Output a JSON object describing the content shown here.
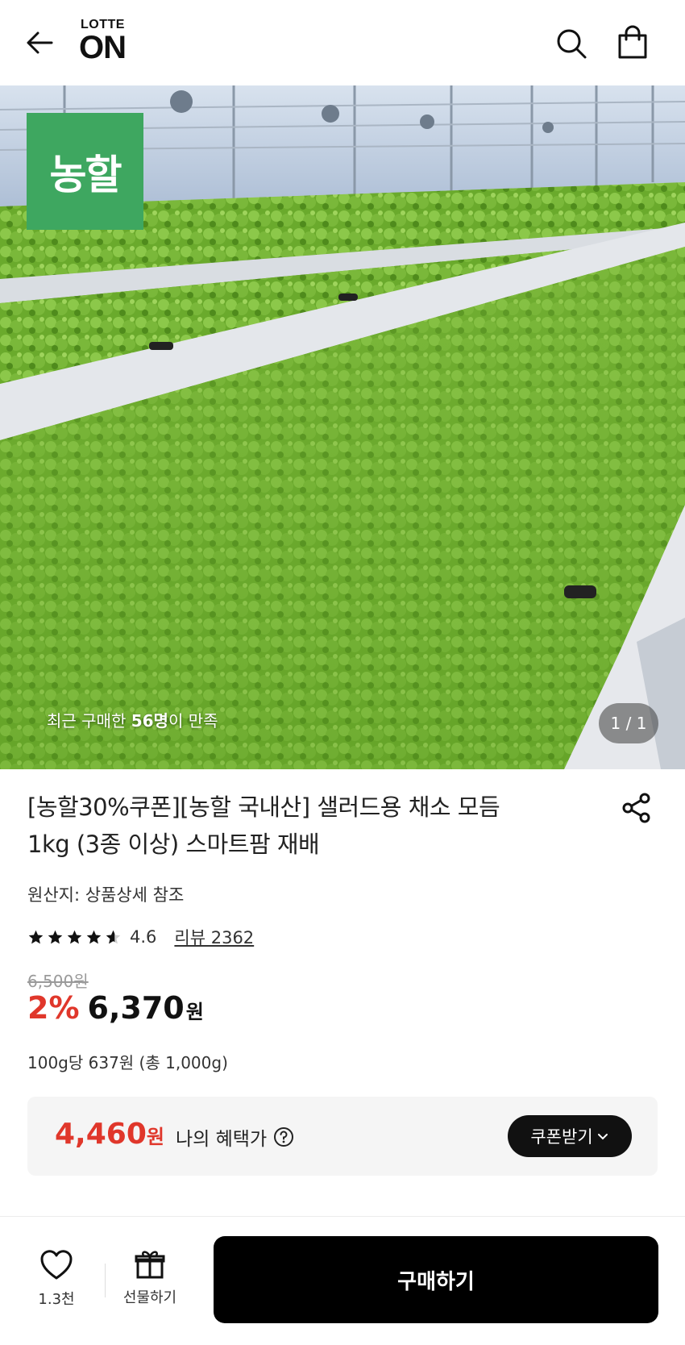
{
  "header": {
    "back_icon": "arrow-left-icon",
    "logo_top": "LOTTE",
    "logo_main": "ON",
    "search_icon": "search-icon",
    "cart_icon": "shopping-bag-icon"
  },
  "hero": {
    "brand_badge": "농할",
    "satisfaction_prefix": "최근 구매한 ",
    "satisfaction_count": "56명",
    "satisfaction_suffix": "이 만족",
    "page_indicator": "1 / 1"
  },
  "product": {
    "title_line1": "[농할30%쿠폰][농할 국내산] 샐러드용 채소 모듬",
    "title_line2": "1kg (3종 이상) 스마트팜 재배",
    "origin": "원산지: 상품상세 참조",
    "rating": "4.6",
    "rating_stars": 4.6,
    "review_link": "리뷰 2362",
    "original_price": "6,500원",
    "discount_rate": "2%",
    "sale_price": "6,370",
    "sale_unit": "원",
    "unit_price": "100g당 637원 (총 1,000g)"
  },
  "benefit": {
    "price": "4,460",
    "unit": "원",
    "label": "나의 혜택가",
    "coupon_button": "쿠폰받기"
  },
  "bottom_bar": {
    "wish_count": "1.3천",
    "gift_label": "선물하기",
    "buy_label": "구매하기"
  },
  "colors": {
    "accent_red": "#e0372b",
    "brand_green": "#3ea760",
    "button_black": "#000000"
  }
}
